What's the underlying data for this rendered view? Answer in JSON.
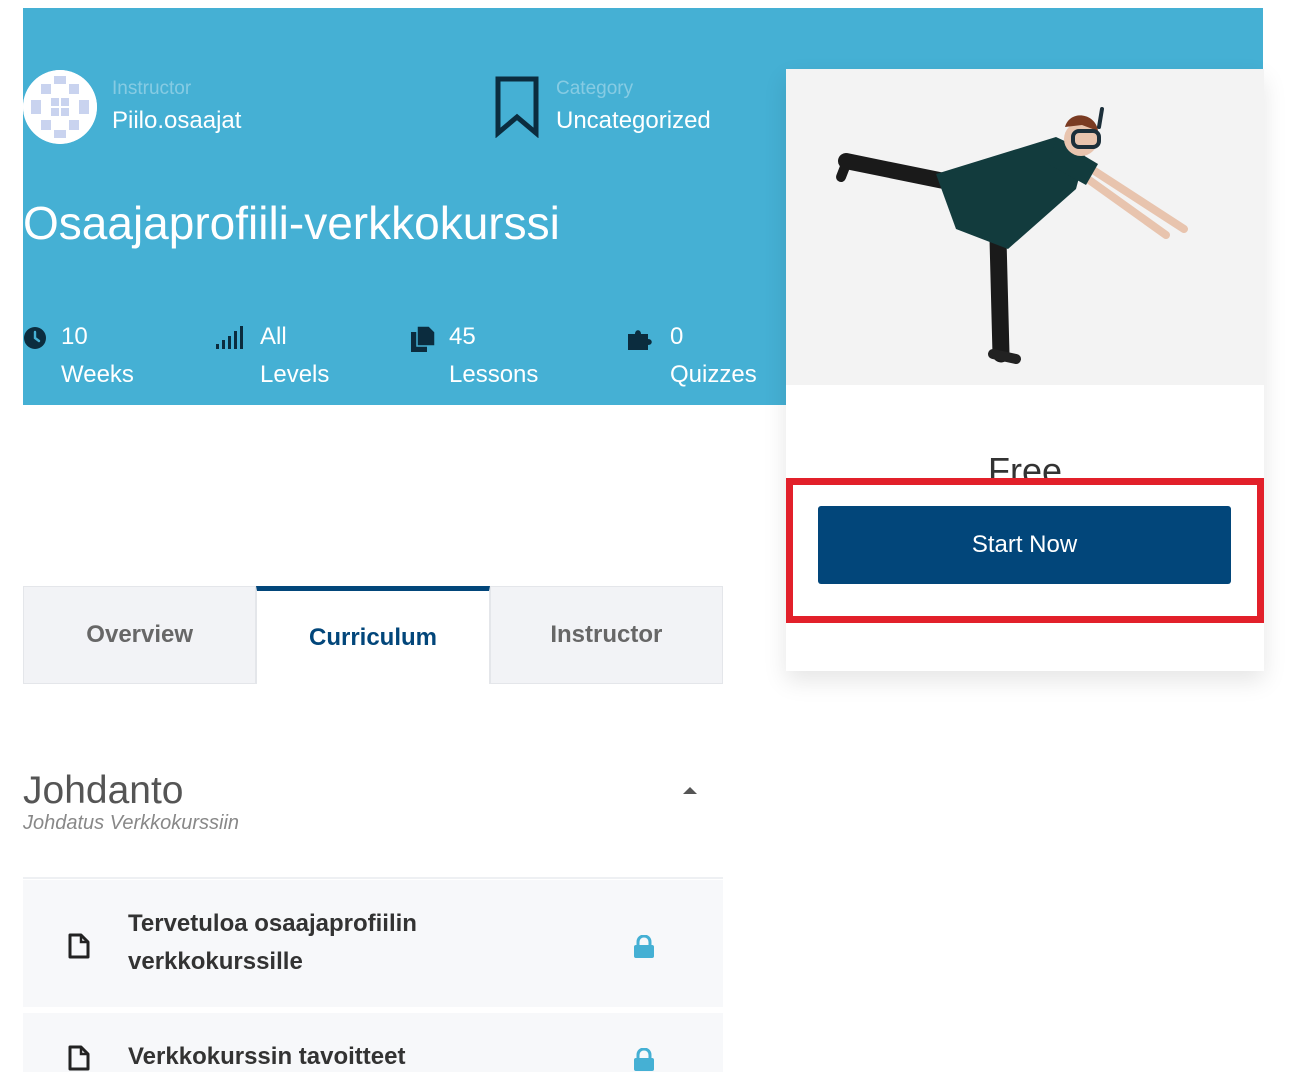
{
  "colors": {
    "hero_background": "#45b0d4",
    "primary_button": "#02467a",
    "highlight_border": "#e2202a",
    "lock_icon": "#45b0d4"
  },
  "course": {
    "instructor_label": "Instructor",
    "instructor_name": "Piilo.osaajat",
    "category_label": "Category",
    "category_value": "Uncategorized",
    "title": "Osaajaprofiili-verkkokurssi",
    "stats": [
      {
        "icon": "clock-icon",
        "value": "10",
        "label": "Weeks"
      },
      {
        "icon": "signal-bars-icon",
        "value": "All",
        "label": "Levels"
      },
      {
        "icon": "documents-icon",
        "value": "45",
        "label": "Lessons"
      },
      {
        "icon": "puzzle-icon",
        "value": "0",
        "label": "Quizzes"
      }
    ]
  },
  "card": {
    "price": "Free",
    "start_button": "Start Now"
  },
  "tabs": [
    {
      "label": "Overview",
      "active": false
    },
    {
      "label": "Curriculum",
      "active": true
    },
    {
      "label": "Instructor",
      "active": false
    }
  ],
  "curriculum": {
    "section_title": "Johdanto",
    "section_subtitle": "Johdatus Verkkokurssiin",
    "lessons": [
      {
        "title": "Tervetuloa osaajaprofiilin verkkokurssille",
        "icon": "document-icon",
        "locked": true
      },
      {
        "title": "Verkkokurssin tavoitteet",
        "icon": "document-icon",
        "locked": true
      }
    ]
  }
}
